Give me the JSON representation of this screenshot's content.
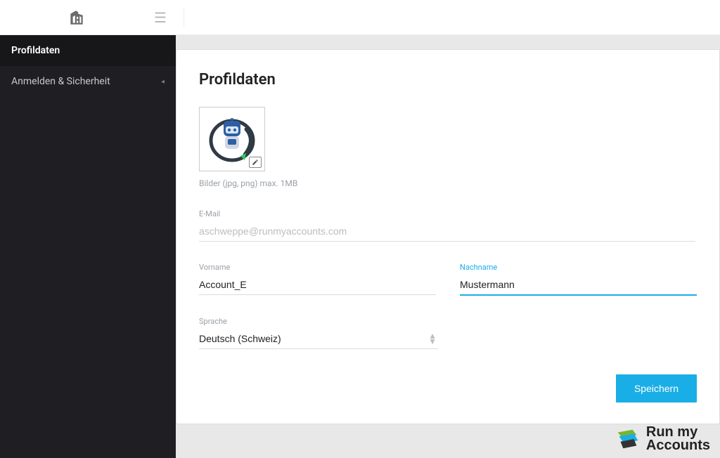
{
  "sidebar": {
    "items": [
      {
        "label": "Profildaten",
        "active": true
      },
      {
        "label": "Anmelden & Sicherheit",
        "active": false
      }
    ]
  },
  "page": {
    "title": "Profildaten",
    "image_hint": "Bilder (jpg, png) max. 1MB"
  },
  "form": {
    "email_label": "E-Mail",
    "email_value": "aschweppe@runmyaccounts.com",
    "firstname_label": "Vorname",
    "firstname_value": "Account_E",
    "lastname_label": "Nachname",
    "lastname_value": "Mustermann",
    "language_label": "Sprache",
    "language_value": "Deutsch (Schweiz)",
    "save_label": "Speichern"
  },
  "brand": {
    "line1": "Run my",
    "line2": "Accounts"
  }
}
